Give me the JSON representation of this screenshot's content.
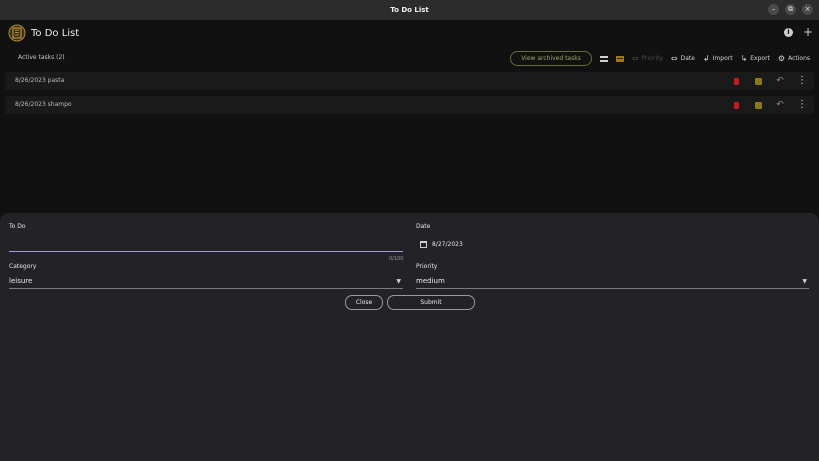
{
  "window": {
    "title": "To Do List",
    "controls": [
      "–",
      "⧉",
      "×"
    ]
  },
  "header": {
    "app_title": "To Do List"
  },
  "toolbar": {
    "active_tasks_label": "Active tasks (2)",
    "view_archived_label": "View archived tasks",
    "priority_label": "Priority",
    "date_label": "Date",
    "import_label": "Import",
    "export_label": "Export",
    "actions_label": "Actions"
  },
  "tasks": [
    {
      "text": "8/26/2023 pasta"
    },
    {
      "text": "8/26/2023 shampo"
    }
  ],
  "form": {
    "todo_label": "To Do",
    "todo_value": "",
    "counter": "0/100",
    "date_label": "Date",
    "date_value": "8/27/2023",
    "category_label": "Category",
    "category_value": "leisure",
    "priority_label": "Priority",
    "priority_value": "medium",
    "close_label": "Close",
    "submit_label": "Submit"
  },
  "colors": {
    "accent": "#a99ad8",
    "delete": "#b52020",
    "archive": "#8a7a10"
  }
}
